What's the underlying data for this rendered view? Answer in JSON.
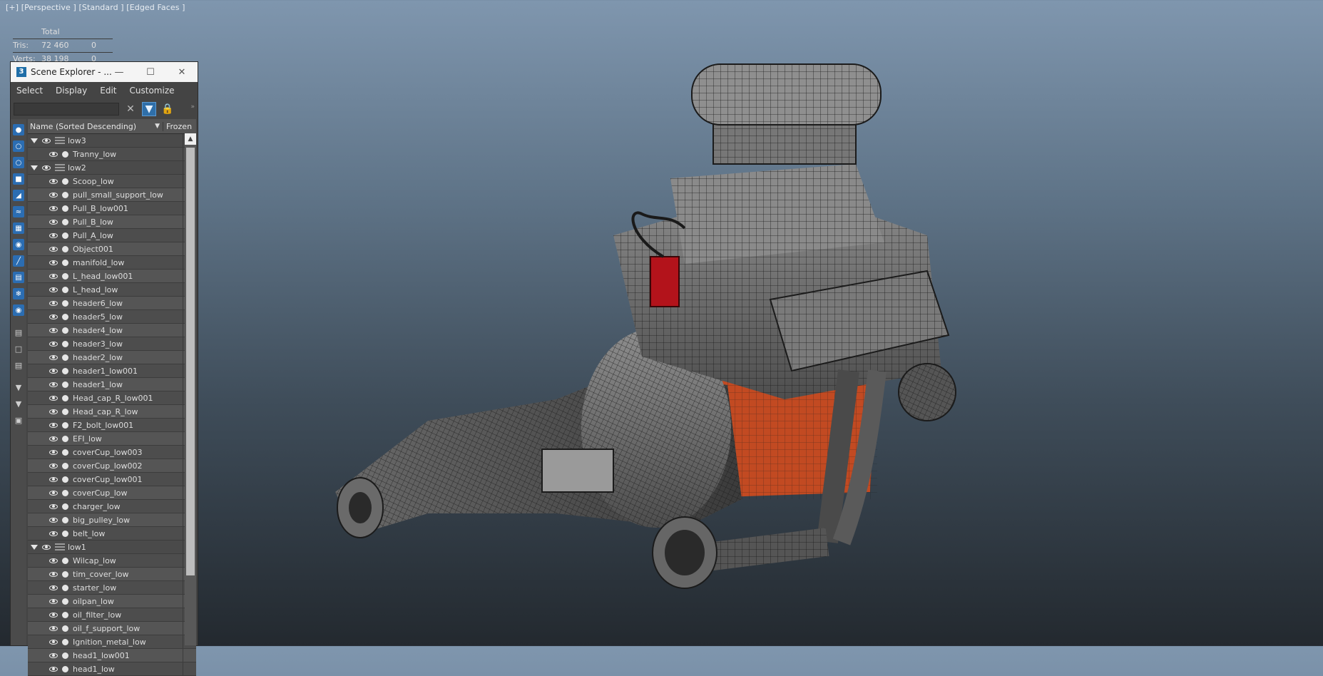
{
  "viewport": {
    "label": "[+] [Perspective ] [Standard ] [Edged Faces ]",
    "stats": {
      "header": "Total",
      "rows": [
        {
          "label": "Tris:",
          "total": "72 460",
          "sel": "0"
        },
        {
          "label": "Verts:",
          "total": "38 198",
          "sel": "0"
        }
      ]
    }
  },
  "scene_explorer": {
    "title": "Scene Explorer - ...",
    "menu": [
      "Select",
      "Display",
      "Edit",
      "Customize"
    ],
    "columns": {
      "name": "Name (Sorted Descending)",
      "frozen": "Frozen"
    },
    "rows": [
      {
        "type": "layer",
        "label": "low3"
      },
      {
        "type": "obj",
        "label": "Tranny_low"
      },
      {
        "type": "layer",
        "label": "low2"
      },
      {
        "type": "obj",
        "label": "Scoop_low"
      },
      {
        "type": "obj",
        "label": "pull_small_support_low"
      },
      {
        "type": "obj",
        "label": "Pull_B_low001"
      },
      {
        "type": "obj",
        "label": "Pull_B_low"
      },
      {
        "type": "obj",
        "label": "Pull_A_low"
      },
      {
        "type": "obj",
        "label": "Object001"
      },
      {
        "type": "obj",
        "label": "manifold_low"
      },
      {
        "type": "obj",
        "label": "L_head_low001"
      },
      {
        "type": "obj",
        "label": "L_head_low"
      },
      {
        "type": "obj",
        "label": "header6_low"
      },
      {
        "type": "obj",
        "label": "header5_low"
      },
      {
        "type": "obj",
        "label": "header4_low"
      },
      {
        "type": "obj",
        "label": "header3_low"
      },
      {
        "type": "obj",
        "label": "header2_low"
      },
      {
        "type": "obj",
        "label": "header1_low001"
      },
      {
        "type": "obj",
        "label": "header1_low"
      },
      {
        "type": "obj",
        "label": "Head_cap_R_low001"
      },
      {
        "type": "obj",
        "label": "Head_cap_R_low"
      },
      {
        "type": "obj",
        "label": "F2_bolt_low001"
      },
      {
        "type": "obj",
        "label": "EFI_low"
      },
      {
        "type": "obj",
        "label": "coverCup_low003"
      },
      {
        "type": "obj",
        "label": "coverCup_low002"
      },
      {
        "type": "obj",
        "label": "coverCup_low001"
      },
      {
        "type": "obj",
        "label": "coverCup_low"
      },
      {
        "type": "obj",
        "label": "charger_low"
      },
      {
        "type": "obj",
        "label": "big_pulley_low"
      },
      {
        "type": "obj",
        "label": "belt_low"
      },
      {
        "type": "layer",
        "label": "low1"
      },
      {
        "type": "obj",
        "label": "Wilcap_low"
      },
      {
        "type": "obj",
        "label": "tim_cover_low"
      },
      {
        "type": "obj",
        "label": "starter_low"
      },
      {
        "type": "obj",
        "label": "oilpan_low"
      },
      {
        "type": "obj",
        "label": "oil_filter_low"
      },
      {
        "type": "obj",
        "label": "oil_f_support_low"
      },
      {
        "type": "obj",
        "label": "Ignition_metal_low"
      },
      {
        "type": "obj",
        "label": "head1_low001"
      },
      {
        "type": "obj",
        "label": "head1_low"
      }
    ]
  },
  "colors": {
    "accent": "#2b6db2",
    "engine_orange": "#c24a22",
    "distributor_red": "#b3131b"
  }
}
